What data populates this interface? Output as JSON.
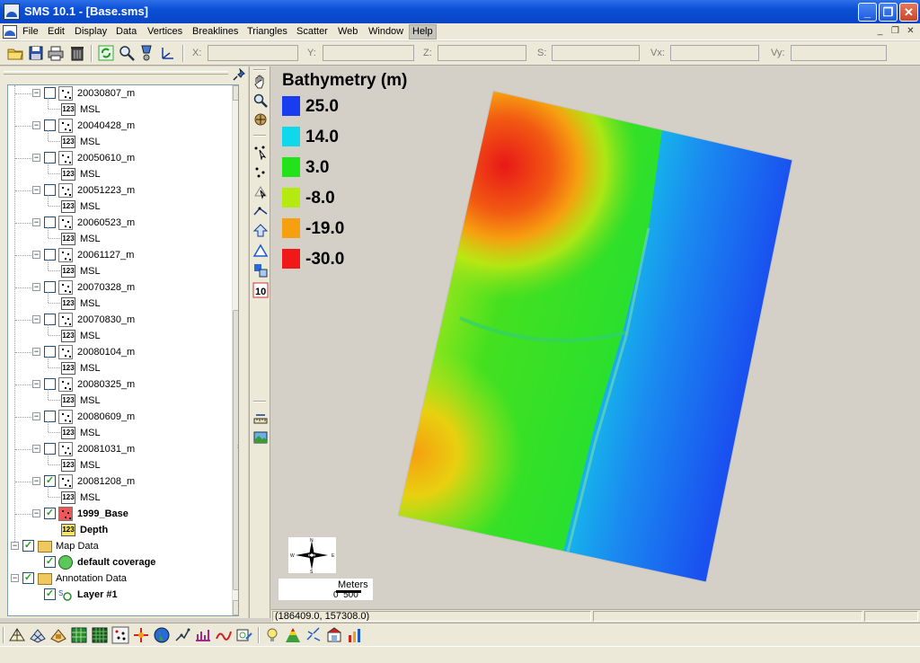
{
  "window": {
    "title": "SMS 10.1 - [Base.sms]",
    "minimize_glyph": "_",
    "maximize_glyph": "❐",
    "close_glyph": "✕"
  },
  "menu": {
    "items": [
      "File",
      "Edit",
      "Display",
      "Data",
      "Vertices",
      "Breaklines",
      "Triangles",
      "Scatter",
      "Web",
      "Window",
      "Help"
    ]
  },
  "toolbar": {
    "coords": [
      {
        "label": "X:",
        "value": ""
      },
      {
        "label": "Y:",
        "value": ""
      },
      {
        "label": "Z:",
        "value": ""
      },
      {
        "label": "S:",
        "value": ""
      },
      {
        "label": "Vx:",
        "value": ""
      },
      {
        "label": "Vy:",
        "value": ""
      }
    ]
  },
  "tree": {
    "datasets": [
      {
        "name": "20030807_m",
        "child": "MSL",
        "checked": false
      },
      {
        "name": "20040428_m",
        "child": "MSL",
        "checked": false
      },
      {
        "name": "20050610_m",
        "child": "MSL",
        "checked": false
      },
      {
        "name": "20051223_m",
        "child": "MSL",
        "checked": false
      },
      {
        "name": "20060523_m",
        "child": "MSL",
        "checked": false
      },
      {
        "name": "20061127_m",
        "child": "MSL",
        "checked": false
      },
      {
        "name": "20070328_m",
        "child": "MSL",
        "checked": false
      },
      {
        "name": "20070830_m",
        "child": "MSL",
        "checked": false
      },
      {
        "name": "20080104_m",
        "child": "MSL",
        "checked": false
      },
      {
        "name": "20080325_m",
        "child": "MSL",
        "checked": false
      },
      {
        "name": "20080609_m",
        "child": "MSL",
        "checked": false
      },
      {
        "name": "20081031_m",
        "child": "MSL",
        "checked": false
      },
      {
        "name": "20081208_m",
        "child": "MSL",
        "checked": true
      }
    ],
    "base": {
      "name": "1999_Base",
      "child": "Depth"
    },
    "map_data": {
      "label": "Map Data",
      "coverage": "default coverage"
    },
    "annotation_data": {
      "label": "Annotation Data",
      "layer": "Layer #1"
    },
    "num_icon_text": "123"
  },
  "legend": {
    "title": "Bathymetry (m)",
    "entries": [
      {
        "value": "25.0",
        "color": "#1a3cf0"
      },
      {
        "value": "14.0",
        "color": "#10d8ea"
      },
      {
        "value": "3.0",
        "color": "#22e21a"
      },
      {
        "value": "-8.0",
        "color": "#b4ea10"
      },
      {
        "value": "-19.0",
        "color": "#f6a010"
      },
      {
        "value": "-30.0",
        "color": "#f01818"
      }
    ]
  },
  "scale_bar": {
    "units": "Meters",
    "ticks": "0  500"
  },
  "status": {
    "cursor_coords": "(186409.0, 157308.0)",
    "cell2": "",
    "cell3": ""
  },
  "colors": {
    "land_red": "#e81818",
    "land_green": "#38e020",
    "shore_cyan": "#10e0d8",
    "deep_blue": "#1850f0"
  }
}
